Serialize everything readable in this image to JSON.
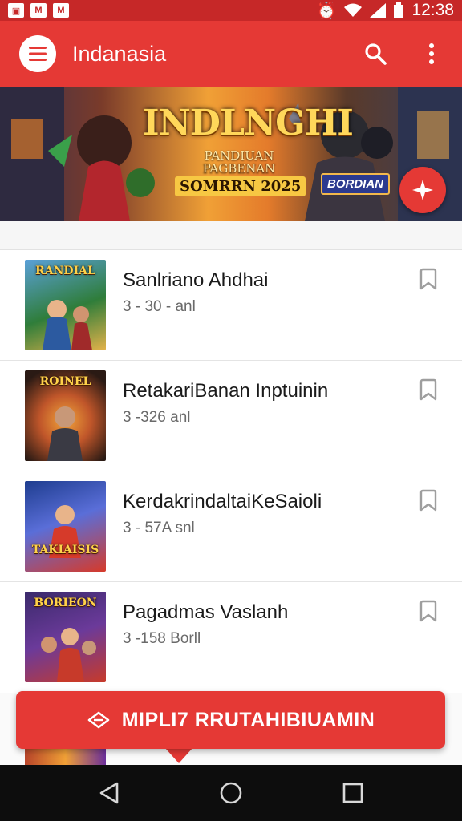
{
  "status_bar": {
    "time": "12:38",
    "icons": [
      "app-notification-icon",
      "gmail-icon",
      "gmail-icon",
      "alarm-icon",
      "wifi-icon",
      "signal-icon",
      "battery-icon"
    ]
  },
  "app_bar": {
    "title": "Indanasia",
    "menu_icon": "hamburger-menu-icon",
    "search_icon": "search-icon",
    "more_icon": "more-vert-icon",
    "color": "#e53935"
  },
  "banner": {
    "title": "INDLNGHI",
    "subtitle_line1": "PANDIUAN",
    "subtitle_line2": "PAGBENAN",
    "date": "SOMRRN 2025",
    "badge": "BORDIAN",
    "fab_icon": "sparkle-icon"
  },
  "items": [
    {
      "title": "Sanlriano Ahdhai",
      "meta": "3 - 30 - anl",
      "thumb_label": "RANDIAL",
      "thumb_colors": [
        "#2f7d3a",
        "#5aa0d8",
        "#e3b24a"
      ]
    },
    {
      "title": "RetakariBanan Inptuinin",
      "meta": "3 -326 anl",
      "thumb_label": "ROINEL",
      "thumb_colors": [
        "#2a1a14",
        "#c0562a",
        "#f1a53a"
      ]
    },
    {
      "title": "KerdakrindaltaiKeSaioli",
      "meta": "3 - 57A snl",
      "thumb_label": "TAKIAISIS",
      "thumb_colors": [
        "#1e3d8f",
        "#d63a2a",
        "#f5c64a"
      ]
    },
    {
      "title": "Pagadmas Vaslanh",
      "meta": "3 -158 Borll",
      "thumb_label": "BORIEON",
      "thumb_colors": [
        "#3a2a6b",
        "#c73a2a",
        "#f0c24a"
      ]
    }
  ],
  "cta": {
    "label": "MIPLI7 RRUTAHIBIUAMIN",
    "icon": "ticket-icon"
  },
  "nav": {
    "back_icon": "back-triangle-icon",
    "home_icon": "home-circle-icon",
    "recents_icon": "recents-square-icon"
  }
}
